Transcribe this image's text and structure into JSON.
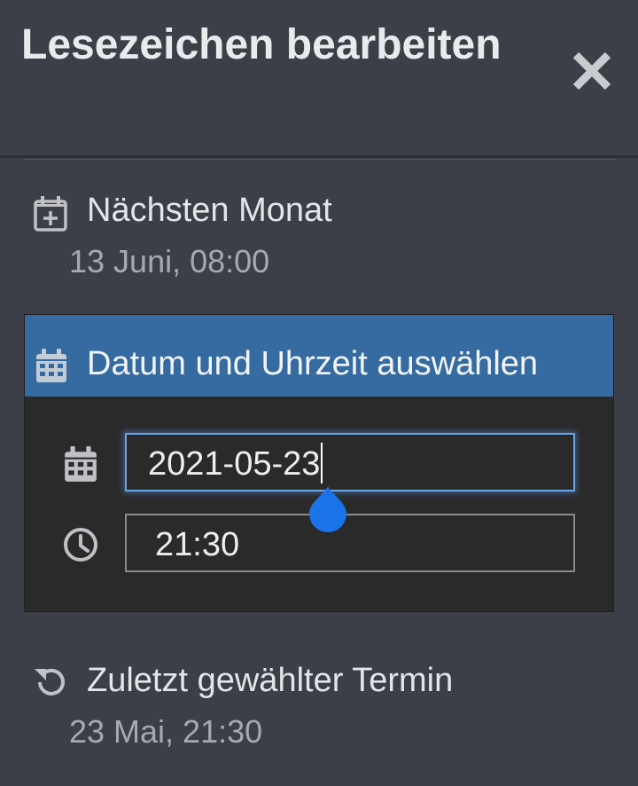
{
  "header": {
    "title": "Lesezeichen bearbeiten"
  },
  "options": {
    "next_month": {
      "label": "Nächsten Monat",
      "detail": "13 Juni, 08:00",
      "icon": "calendar-plus-icon"
    },
    "last_used": {
      "label": "Zuletzt gewählter Termin",
      "detail": "23 Mai, 21:30",
      "icon": "history-icon"
    }
  },
  "picker": {
    "heading": "Datum und Uhrzeit auswählen",
    "date_value": "2021-05-23",
    "time_value": "21:30"
  },
  "colors": {
    "background": "#3c3f47",
    "picker_header": "#356ba1",
    "picker_body": "#2a2a2b",
    "focus_border": "#6aa5e6",
    "handle": "#1a73e8"
  }
}
